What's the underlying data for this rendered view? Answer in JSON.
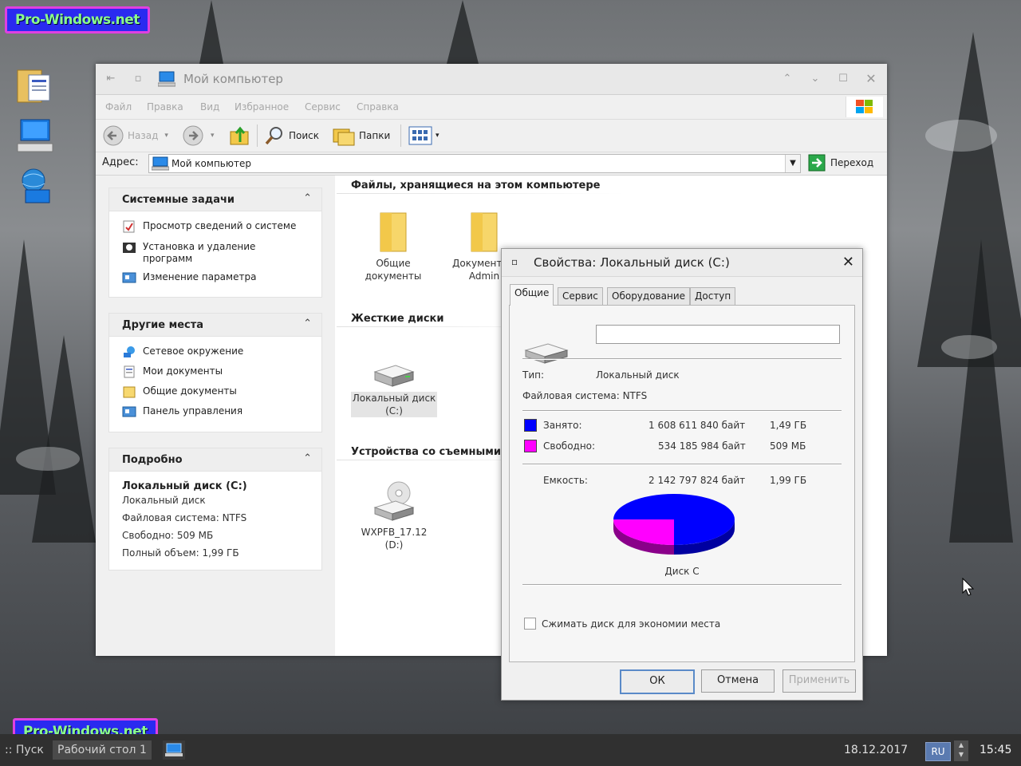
{
  "desktop": {
    "watermark_top": "Pro-Windows.net",
    "watermark_bottom": "Pro-Windows.net"
  },
  "explorer": {
    "title": "Мой компьютер",
    "menu": [
      "Файл",
      "Правка",
      "Вид",
      "Избранное",
      "Сервис",
      "Справка"
    ],
    "toolbar": {
      "back": "Назад",
      "search": "Поиск",
      "folders": "Папки"
    },
    "address": {
      "label": "Адрес:",
      "value": "Мой компьютер",
      "go": "Переход"
    },
    "system_tasks": {
      "title": "Системные задачи",
      "items": [
        "Просмотр сведений о системе",
        "Установка и удаление программ",
        "Изменение параметра"
      ]
    },
    "other_places": {
      "title": "Другие места",
      "items": [
        "Сетевое окружение",
        "Мои документы",
        "Общие документы",
        "Панель управления"
      ]
    },
    "details": {
      "title": "Подробно",
      "name": "Локальный диск (C:)",
      "type": "Локальный диск",
      "fs": "Файловая система: NTFS",
      "free": "Свободно: 509 МБ",
      "total": "Полный объем: 1,99 ГБ"
    },
    "files_section": "Файлы, хранящиеся на этом компьютере",
    "shared_docs": "Общие документы",
    "admin_docs": "Документы - Admin",
    "hdd_section": "Жесткие диски",
    "local_disk": "Локальный диск (C:)",
    "removable_section": "Устройства со съемными",
    "cd_drive": "WXPFB_17.12 (D:)"
  },
  "dialog": {
    "title": "Свойства: Локальный диск (C:)",
    "tabs": [
      "Общие",
      "Сервис",
      "Оборудование",
      "Доступ"
    ],
    "label_value": "",
    "type_label": "Тип:",
    "type_value": "Локальный диск",
    "fs_text": "Файловая система:  NTFS",
    "used_label": "Занято:",
    "used_bytes": "1 608 611 840 байт",
    "used_h": "1,49 ГБ",
    "free_label": "Свободно:",
    "free_bytes": "534 185 984 байт",
    "free_h": "509 МБ",
    "cap_label": "Емкость:",
    "cap_bytes": "2 142 797 824 байт",
    "cap_h": "1,99 ГБ",
    "pie_label": "Диск C",
    "compress": "Сжимать диск для экономии места",
    "ok": "ОК",
    "cancel": "Отмена",
    "apply": "Применить",
    "colors": {
      "used": "#0000ff",
      "free": "#ff00ff"
    },
    "used_fraction": 0.7507
  },
  "taskbar": {
    "start": ":: Пуск",
    "desktop": "Рабочий стол 1",
    "date": "18.12.2017",
    "lang": "RU",
    "time": "15:45"
  }
}
